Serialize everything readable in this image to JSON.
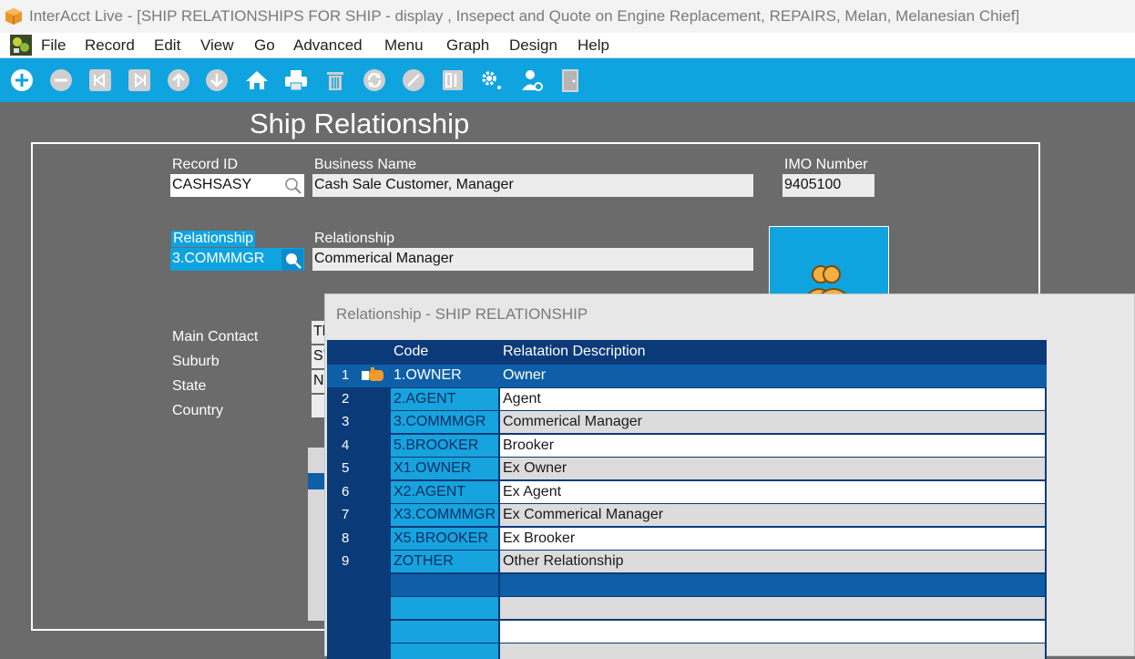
{
  "window": {
    "title": "InterAcct Live - [SHIP RELATIONSHIPS FOR SHIP - display , Insepect and Quote on Engine Replacement, REPAIRS, Melan, Melanesian Chief]"
  },
  "menubar": {
    "items": [
      "File",
      "Record",
      "Edit",
      "View",
      "Go",
      "Advanced",
      "Menu",
      "Graph",
      "Design",
      "Help"
    ]
  },
  "toolbar": {
    "icons": [
      "add-icon",
      "remove-icon",
      "first-record-icon",
      "last-record-icon",
      "up-icon",
      "down-icon",
      "home-icon",
      "print-icon",
      "delete-icon",
      "refresh-icon",
      "cancel-icon",
      "calculator-icon",
      "settings-icon",
      "user-settings-icon",
      "exit-door-icon"
    ]
  },
  "page": {
    "title": "Ship Relationship"
  },
  "form": {
    "record_id_label": "Record ID",
    "record_id_value": "CASHSASY",
    "business_name_label": "Business Name",
    "business_name_value": "Cash Sale Customer,  Manager",
    "imo_label": "IMO Number",
    "imo_value": "9405100",
    "relationship_label": "Relationship",
    "relationship_value": "3.COMMMGR",
    "relationship_desc_label": "Relationship",
    "relationship_desc_value": "Commerical Manager",
    "main_contact_label": "Main Contact",
    "suburb_label": "Suburb",
    "state_label": "State",
    "country_label": "Country",
    "partial_main_contact": "Th",
    "partial_suburb": "SY",
    "partial_state": "NS"
  },
  "dialog": {
    "title": "Relationship - SHIP RELATIONSHIP",
    "columns": [
      "Code",
      "Relatation Description"
    ],
    "rows": [
      {
        "num": "1",
        "code": "1.OWNER",
        "desc": "Owner"
      },
      {
        "num": "2",
        "code": "2.AGENT",
        "desc": "Agent"
      },
      {
        "num": "3",
        "code": "3.COMMMGR",
        "desc": "Commerical Manager"
      },
      {
        "num": "4",
        "code": "5.BROOKER",
        "desc": "Brooker"
      },
      {
        "num": "5",
        "code": "X1.OWNER",
        "desc": "Ex Owner"
      },
      {
        "num": "6",
        "code": "X2.AGENT",
        "desc": "Ex Agent"
      },
      {
        "num": "7",
        "code": "X3.COMMMGR",
        "desc": "Ex Commerical Manager"
      },
      {
        "num": "8",
        "code": "X5.BROOKER",
        "desc": "Ex Brooker"
      },
      {
        "num": "9",
        "code": "ZOTHER",
        "desc": "Other Relationship"
      }
    ]
  },
  "colors": {
    "toolbar": "#0fa3e0",
    "background": "#6b6b6b",
    "grid_dark": "#0b3a78",
    "selected_row": "#0e5fa8"
  }
}
